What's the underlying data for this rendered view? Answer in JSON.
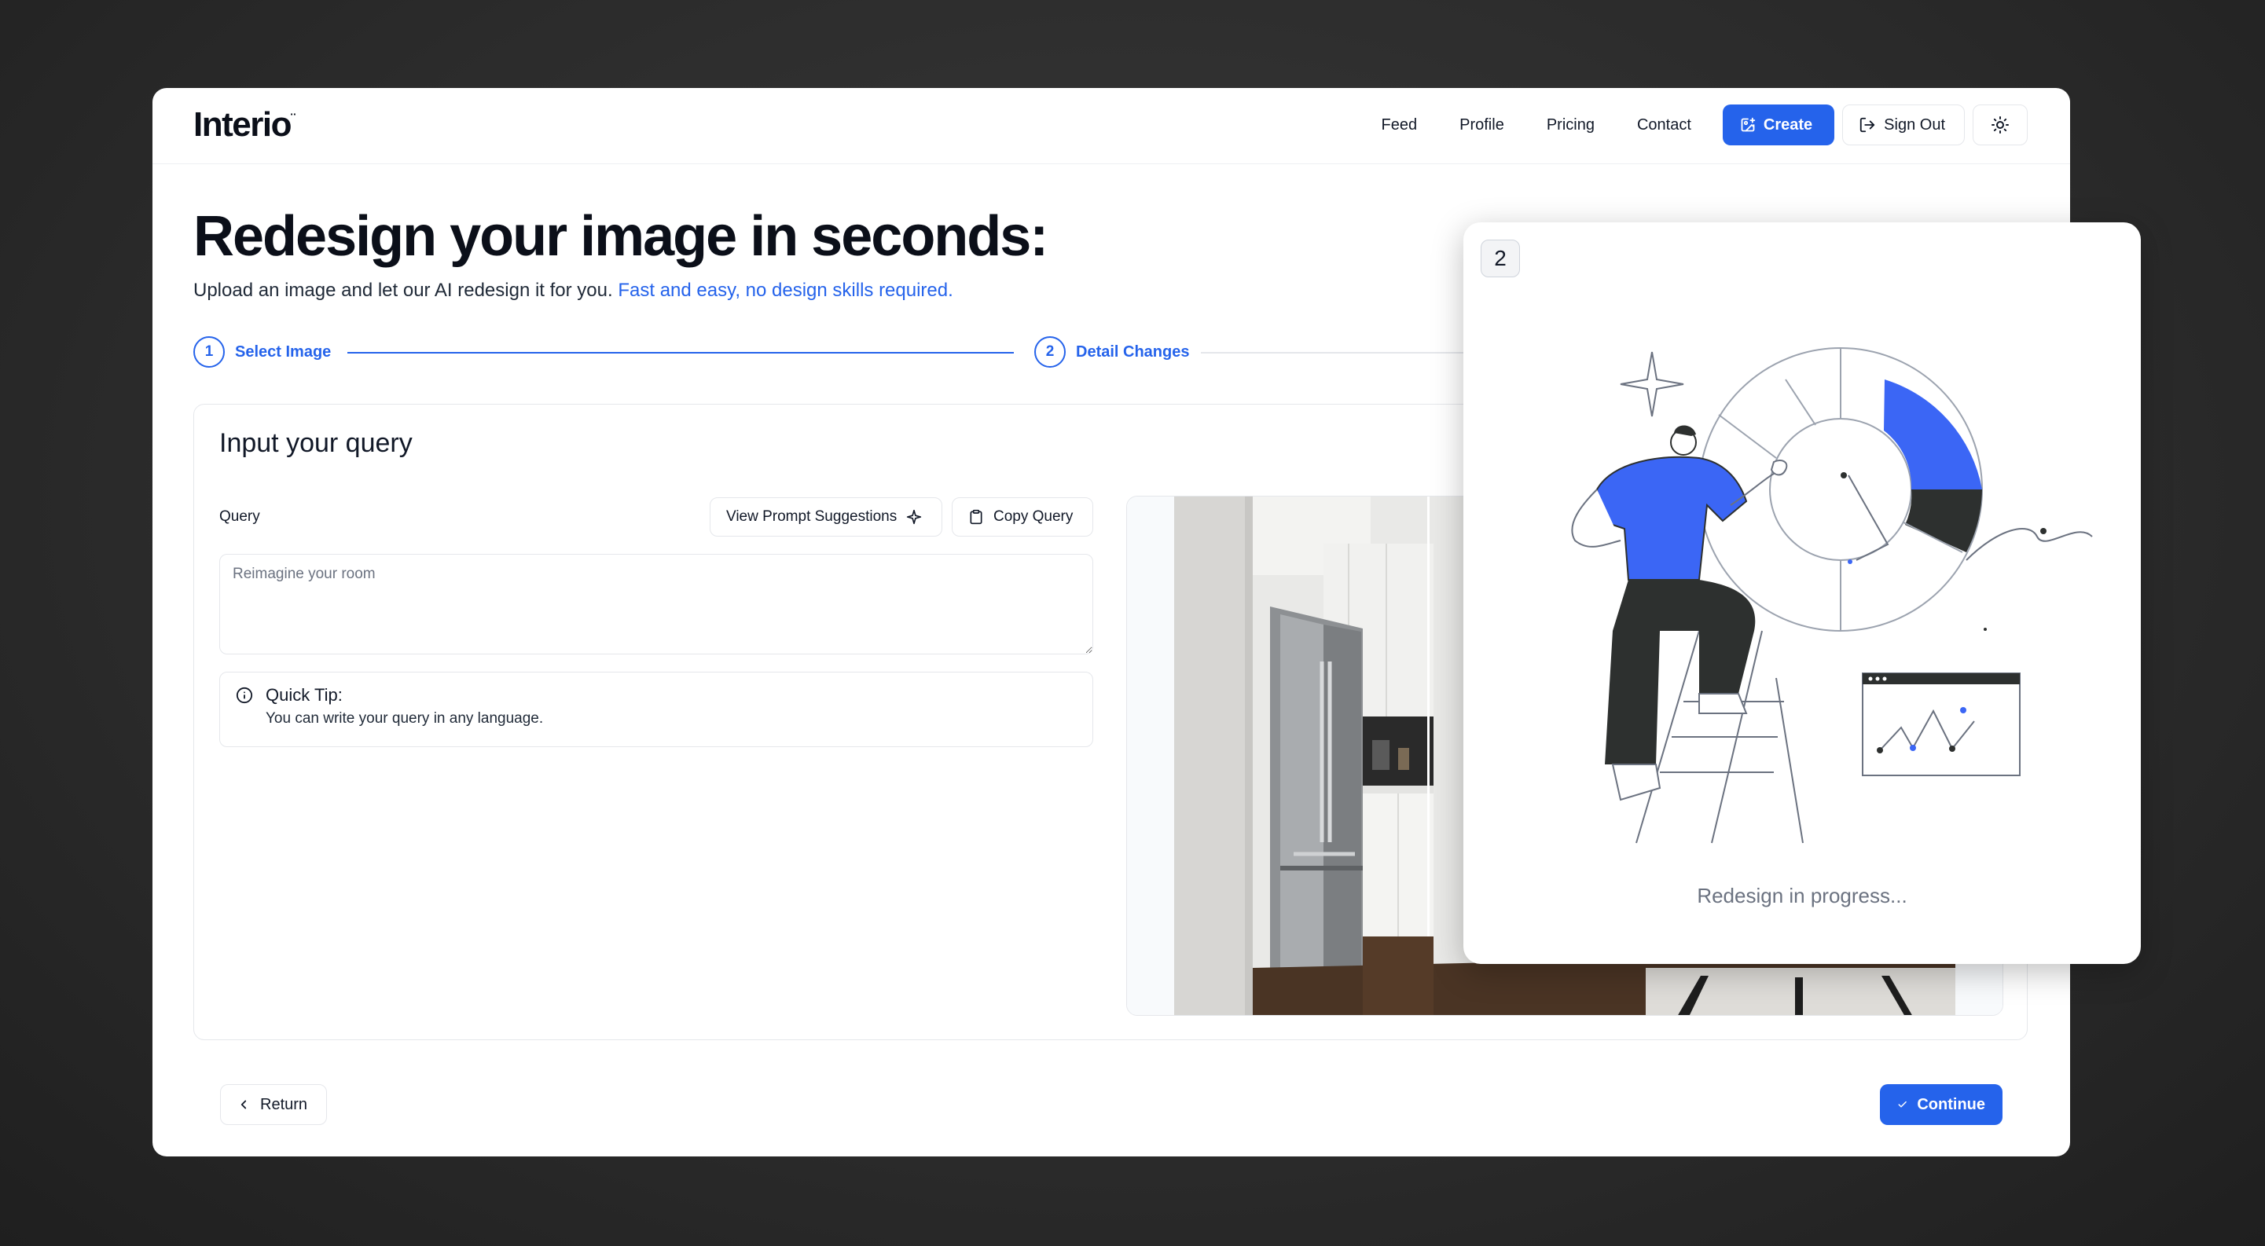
{
  "app": {
    "logo": "Interio",
    "logo_mark": "¨"
  },
  "nav": {
    "links": [
      "Feed",
      "Profile",
      "Pricing",
      "Contact"
    ],
    "create_label": "Create",
    "signout_label": "Sign Out",
    "theme_icon": "sun-icon"
  },
  "hero": {
    "title": "Redesign your image in seconds:",
    "subtitle": "Upload an image and let our AI redesign it for you.",
    "subtitle_highlight": "Fast and easy, no design skills required."
  },
  "stepper": {
    "steps": [
      {
        "number": "1",
        "label": "Select Image"
      },
      {
        "number": "2",
        "label": "Detail Changes"
      }
    ]
  },
  "card": {
    "title": "Input your query",
    "query_label": "Query",
    "suggestions_label": "View Prompt Suggestions",
    "copy_label": "Copy Query",
    "query_placeholder": "Reimagine your room",
    "query_value": "",
    "tip_title": "Quick Tip:",
    "tip_text": "You can write your query in any language."
  },
  "footer": {
    "return_label": "Return",
    "continue_label": "Continue"
  },
  "modal": {
    "badge": "2",
    "status": "Redesign in progress..."
  },
  "colors": {
    "accent": "#2563eb",
    "figure_blue": "#3b66f5",
    "dark": "#2d302f"
  }
}
